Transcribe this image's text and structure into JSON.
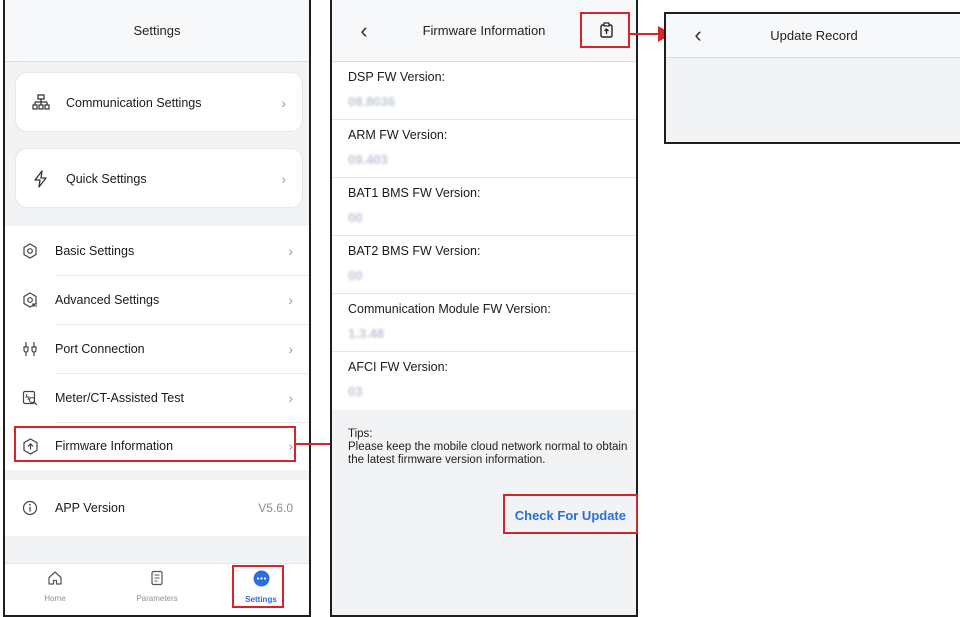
{
  "settings": {
    "title": "Settings",
    "card_items": [
      {
        "label": "Communication Settings",
        "icon": "network-icon"
      },
      {
        "label": "Quick Settings",
        "icon": "lightning-icon"
      }
    ],
    "list_items": [
      {
        "label": "Basic Settings",
        "icon": "gear-icon"
      },
      {
        "label": "Advanced Settings",
        "icon": "advanced-gear-icon"
      },
      {
        "label": "Port Connection",
        "icon": "port-icon"
      },
      {
        "label": "Meter/CT-Assisted Test",
        "icon": "meter-test-icon"
      },
      {
        "label": "Firmware Information",
        "icon": "firmware-upload-icon"
      }
    ],
    "app_version": {
      "label": "APP Version",
      "value": "V5.6.0",
      "icon": "info-icon"
    },
    "tabs": [
      {
        "label": "Home",
        "icon": "home-icon"
      },
      {
        "label": "Parameters",
        "icon": "document-icon"
      },
      {
        "label": "Settings",
        "icon": "more-dots-icon"
      }
    ]
  },
  "firmware": {
    "title": "Firmware Information",
    "items": [
      {
        "label": "DSP FW Version:",
        "value": "08.8036"
      },
      {
        "label": "ARM FW Version:",
        "value": "09.403"
      },
      {
        "label": "BAT1 BMS FW Version:",
        "value": "00"
      },
      {
        "label": "BAT2 BMS FW Version:",
        "value": "00"
      },
      {
        "label": "Communication Module FW Version:",
        "value": "1.3.48"
      },
      {
        "label": "AFCI FW Version:",
        "value": "03"
      }
    ],
    "tips_title": "Tips:",
    "tips_text": "Please keep the mobile cloud network normal to obtain the latest firmware version information.",
    "check_button": "Check For Update"
  },
  "update_record": {
    "title": "Update Record"
  },
  "colors": {
    "accent": "#2a6fe0",
    "highlight": "#d8232a"
  }
}
